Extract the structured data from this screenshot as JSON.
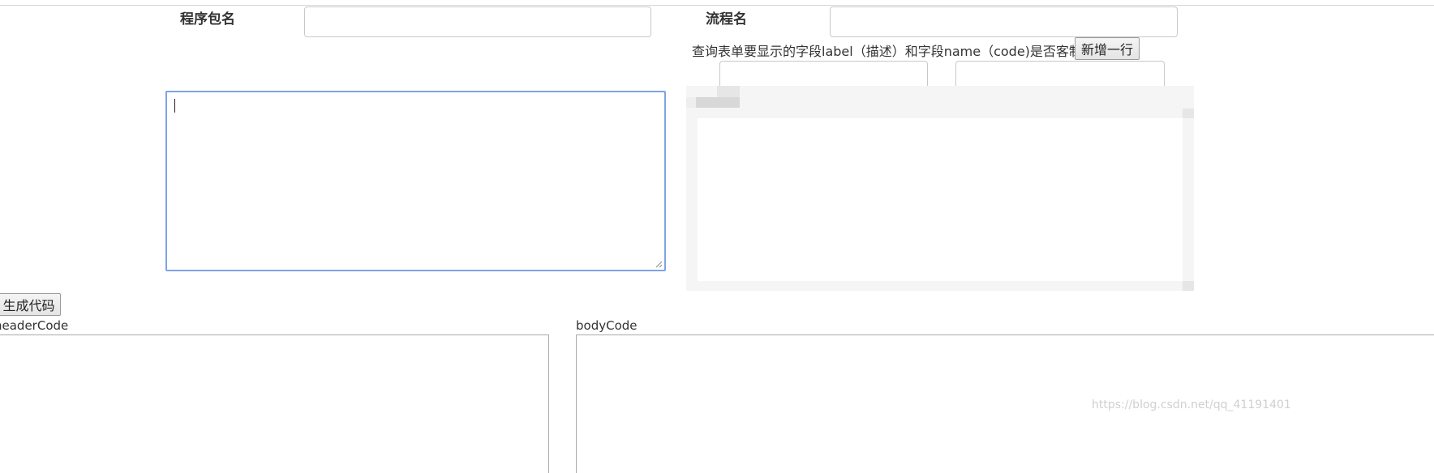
{
  "form": {
    "package_label": "程序包名",
    "package_value": "",
    "flow_label": "流程名",
    "flow_value": "",
    "query_fields_desc": "查询表单要显示的字段label（描述）和字段name（code)是否客制化",
    "add_row_label": "新增一行",
    "field_label_value": "",
    "field_name_value": "",
    "main_textarea_value": ""
  },
  "actions": {
    "generate_label": "生成代码"
  },
  "output": {
    "header_label": "headerCode",
    "header_value": "",
    "body_label": "bodyCode",
    "body_value": ""
  },
  "watermark": "https://blog.csdn.net/qq_41191401"
}
